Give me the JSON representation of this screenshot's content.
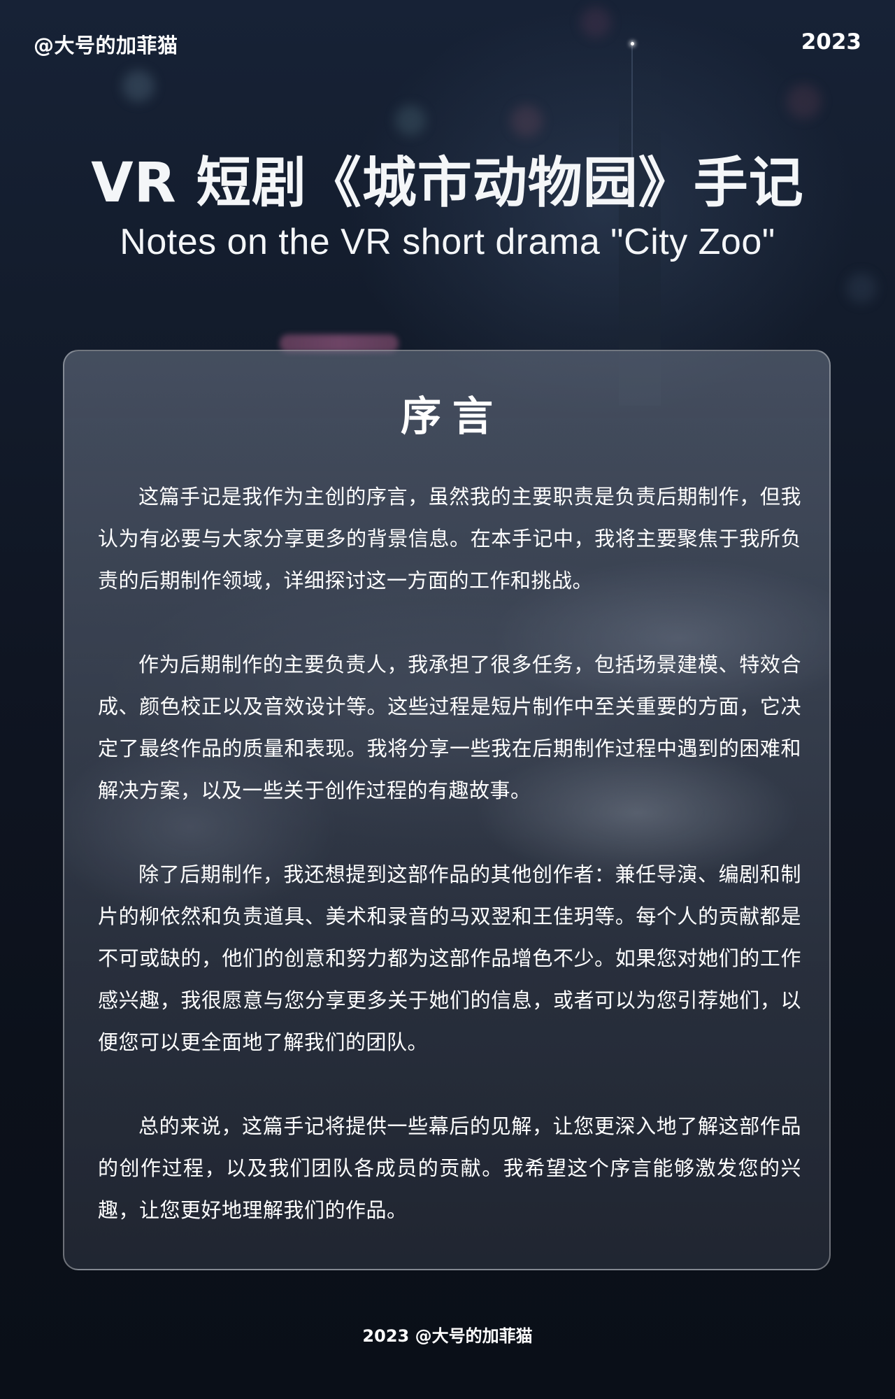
{
  "header": {
    "handle": "@大号的加菲猫",
    "year": "2023"
  },
  "title": {
    "zh": "VR 短剧《城市动物园》手记",
    "en": "Notes on the VR short drama \"City Zoo\""
  },
  "card": {
    "heading": "序言",
    "paragraphs": [
      "这篇手记是我作为主创的序言，虽然我的主要职责是负责后期制作，但我认为有必要与大家分享更多的背景信息。在本手记中，我将主要聚焦于我所负责的后期制作领域，详细探讨这一方面的工作和挑战。",
      "作为后期制作的主要负责人，我承担了很多任务，包括场景建模、特效合成、颜色校正以及音效设计等。这些过程是短片制作中至关重要的方面，它决定了最终作品的质量和表现。我将分享一些我在后期制作过程中遇到的困难和解决方案，以及一些关于创作过程的有趣故事。",
      "除了后期制作，我还想提到这部作品的其他创作者：兼任导演、编剧和制片的柳依然和负责道具、美术和录音的马双翌和王佳玥等。每个人的贡献都是不可或缺的，他们的创意和努力都为这部作品增色不少。如果您对她们的工作感兴趣，我很愿意与您分享更多关于她们的信息，或者可以为您引荐她们，以便您可以更全面地了解我们的团队。",
      "总的来说，这篇手记将提供一些幕后的见解，让您更深入地了解这部作品的创作过程，以及我们团队各成员的贡献。我希望这个序言能够激发您的兴趣，让您更好地理解我们的作品。"
    ]
  },
  "footer": {
    "text": "2023 @大号的加菲猫"
  }
}
